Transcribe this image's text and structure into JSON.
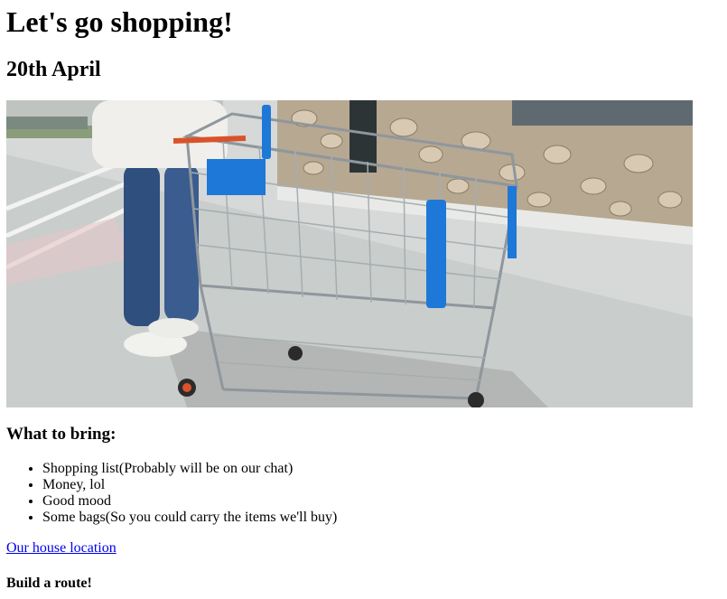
{
  "page": {
    "title": "Let's go shopping!",
    "date": "20th April"
  },
  "image": {
    "name": "shopping-cart-photo"
  },
  "bring": {
    "heading": "What to bring:",
    "items": [
      "Shopping list(Probably will be on our chat)",
      "Money, lol",
      "Good mood",
      "Some bags(So you could carry the items we'll buy)"
    ]
  },
  "location_link": "Our house location",
  "route_heading": "Build a route!",
  "colors": {
    "link": "#0000ee",
    "cart_blue": "#1e78d8",
    "cart_handle_red": "#d9532a",
    "cart_frame": "#8f979c"
  }
}
